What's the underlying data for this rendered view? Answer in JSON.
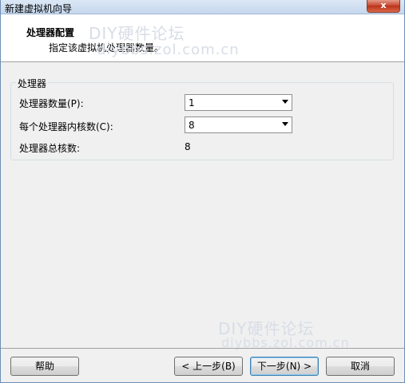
{
  "window": {
    "title": "新建虚拟机向导",
    "close_glyph": "x"
  },
  "header": {
    "title": "处理器配置",
    "subtitle": "指定该虚拟机处理器数量。"
  },
  "processor_group": {
    "label": "处理器",
    "rows": [
      {
        "label": "处理器数量(P):",
        "value": "1"
      },
      {
        "label": "每个处理器内核数(C):",
        "value": "8"
      }
    ],
    "total": {
      "label": "处理器总核数:",
      "value": "8"
    }
  },
  "watermarks": {
    "top_line1": "DIY硬件论坛",
    "top_line2": "diybbs.zol.com.cn",
    "bottom_line1": "DIY硬件论坛",
    "bottom_line2": "diybbs.zol.com.cn"
  },
  "footer": {
    "help": "帮助",
    "back": "< 上一步(B)",
    "next": "下一步(N) >",
    "cancel": "取消"
  },
  "colors": {
    "header_bg": "#ffffff",
    "window_bg": "#f0f0f0",
    "default_button_border": "#3c7fb1",
    "close_button": "#c8492f"
  }
}
